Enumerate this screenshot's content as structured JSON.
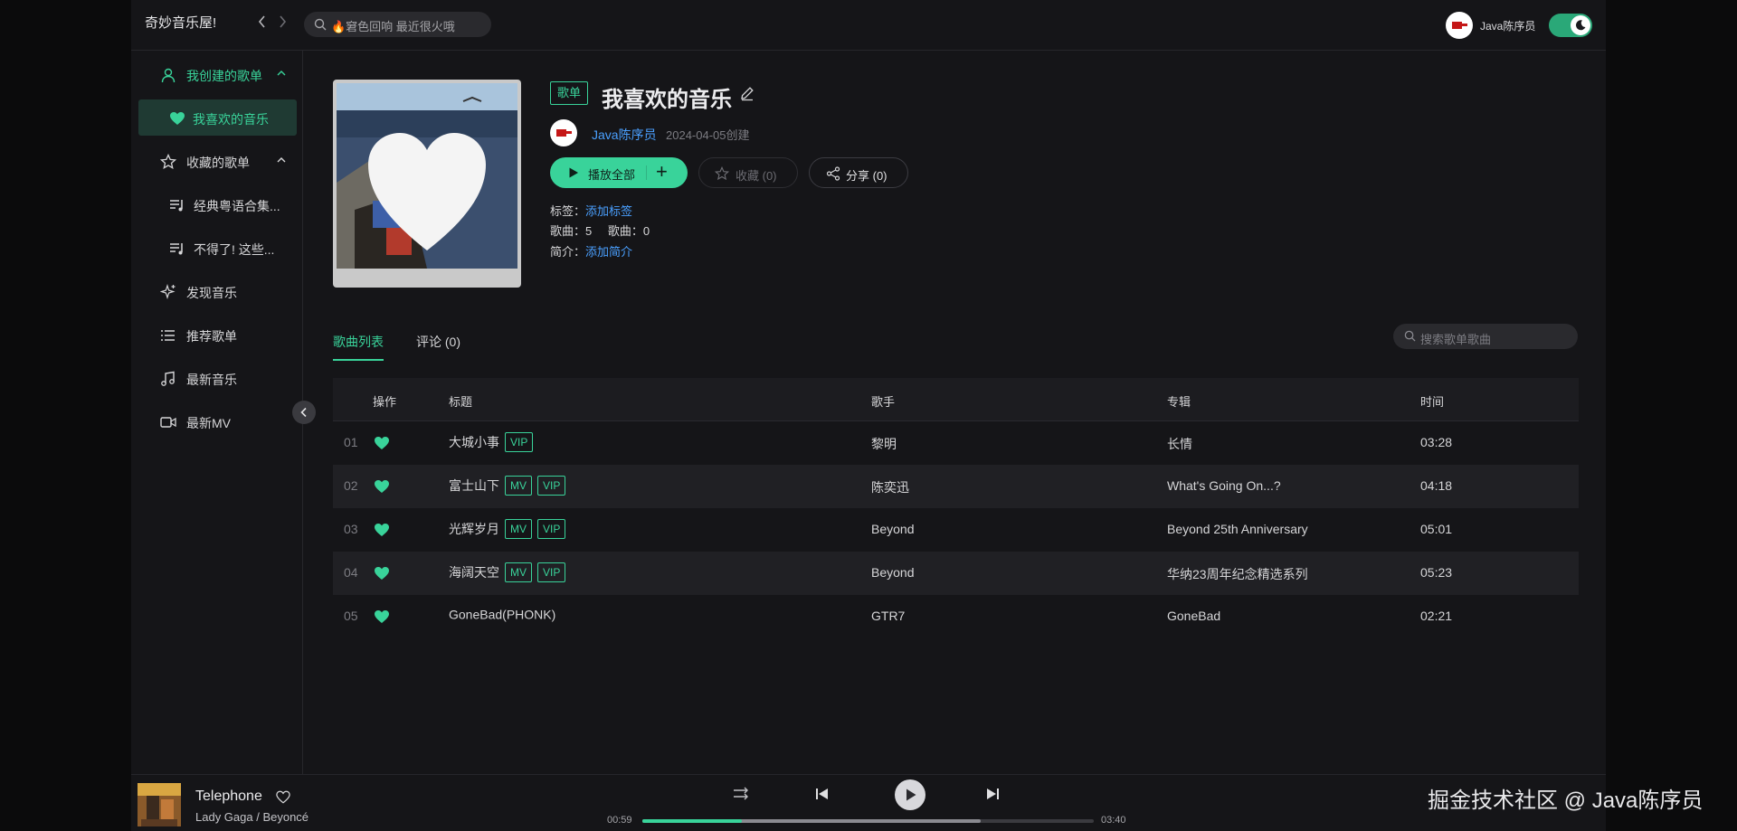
{
  "header": {
    "brand": "奇妙音乐屋!",
    "search_text": "🔥窘色回响 最近很火哦",
    "user_name": "Java陈序员"
  },
  "sidebar": {
    "my_playlists": "我创建的歌单",
    "favorite_music": "我喜欢的音乐",
    "collected_playlists": "收藏的歌单",
    "collected_items": [
      "经典粤语合集...",
      "不得了! 这些..."
    ],
    "discover": "发现音乐",
    "recommended": "推荐歌单",
    "new_music": "最新音乐",
    "new_mv": "最新MV"
  },
  "playlist": {
    "badge": "歌单",
    "title": "我喜欢的音乐",
    "owner": "Java陈序员",
    "created": "2024-04-05创建",
    "play_all": "播放全部",
    "collect": "收藏 (0)",
    "share": "分享 (0)",
    "tags_label": "标签：",
    "tags_link": "添加标签",
    "songs_label": "歌曲：",
    "songs_count": "5",
    "plays_label": "歌曲：",
    "plays_count": "0",
    "intro_label": "简介：",
    "intro_link": "添加简介"
  },
  "tabs": {
    "songs": "歌曲列表",
    "comments": "评论 (0)"
  },
  "list_search_placeholder": "搜索歌单歌曲",
  "table": {
    "headers": {
      "ops": "操作",
      "title": "标题",
      "artist": "歌手",
      "album": "专辑",
      "time": "时间"
    },
    "rows": [
      {
        "idx": "01",
        "title": "大城小事",
        "badges": [
          "VIP"
        ],
        "artist": "黎明",
        "album": "长情",
        "time": "03:28"
      },
      {
        "idx": "02",
        "title": "富士山下",
        "badges": [
          "MV",
          "VIP"
        ],
        "artist": "陈奕迅",
        "album": "What's Going On...?",
        "time": "04:18"
      },
      {
        "idx": "03",
        "title": "光辉岁月",
        "badges": [
          "MV",
          "VIP"
        ],
        "artist": "Beyond",
        "album": "Beyond 25th Anniversary",
        "time": "05:01"
      },
      {
        "idx": "04",
        "title": "海阔天空",
        "badges": [
          "MV",
          "VIP"
        ],
        "artist": "Beyond",
        "album": "华纳23周年纪念精选系列",
        "time": "05:23"
      },
      {
        "idx": "05",
        "title": "GoneBad(PHONK)",
        "badges": [],
        "artist": "GTR7",
        "album": "GoneBad",
        "time": "02:21"
      }
    ]
  },
  "player": {
    "title": "Telephone",
    "artist": "Lady Gaga / Beyoncé",
    "current_time": "00:59",
    "total_time": "03:40",
    "progress_fraction": 0.22,
    "buffered_fraction": 0.75
  },
  "watermark": "掘金技术社区 @ Java陈序员",
  "colors": {
    "accent": "#39d39a",
    "link": "#4aa0ff",
    "background": "#151518"
  }
}
